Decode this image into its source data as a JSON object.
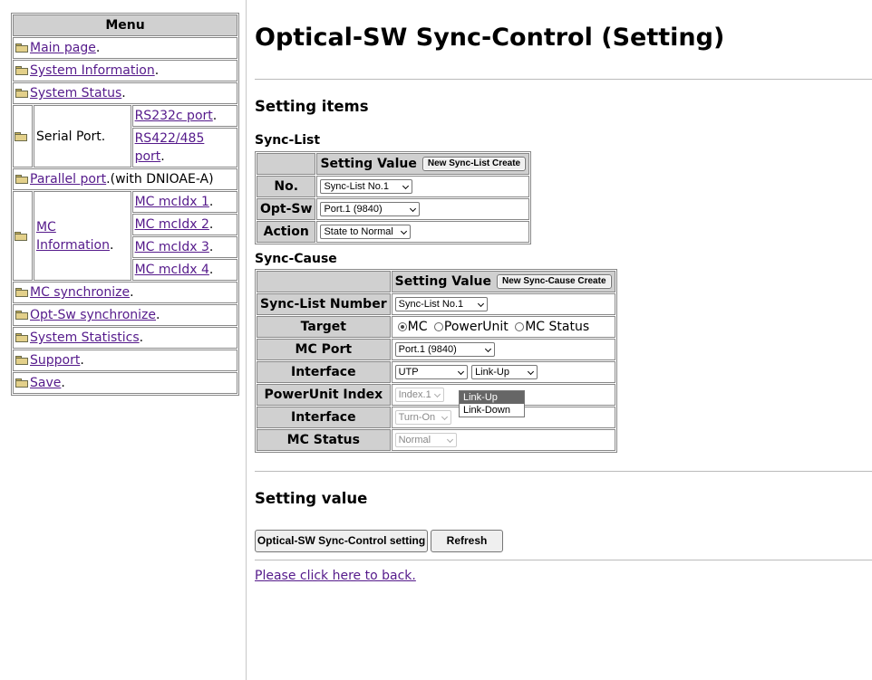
{
  "menu": {
    "title": "Menu",
    "main_page": "Main page",
    "system_information": "System Information",
    "system_status": "System Status",
    "serial_port": "Serial Port.",
    "rs232c_port": "RS232c port",
    "rs422_485_port_line1": "RS422/485",
    "rs422_485_port_line2": "port",
    "parallel_port": "Parallel port",
    "parallel_suffix": "(with DNIOAE-A)",
    "mc_information_line1": "MC",
    "mc_information_line2": "Information",
    "mc_idx_1": "MC mcIdx 1",
    "mc_idx_2": "MC mcIdx 2",
    "mc_idx_3": "MC mcIdx 3",
    "mc_idx_4": "MC mcIdx 4",
    "mc_synchronize": "MC synchronize",
    "opt_sw_synchronize": "Opt-Sw synchronize",
    "system_statistics": "System Statistics",
    "support": "Support",
    "save": "Save",
    "dot": "."
  },
  "page": {
    "title": "Optical-SW Sync-Control (Setting)",
    "setting_items": "Setting items",
    "sync_list_heading": "Sync-List",
    "sync_cause_heading": "Sync-Cause",
    "setting_value_heading": "Setting value",
    "back_link": "Please click here to back."
  },
  "sync_list": {
    "header": "Setting Value",
    "create_button": "New Sync-List Create",
    "no_label": "No.",
    "no_value": "Sync-List No.1",
    "optsw_label": "Opt-Sw",
    "optsw_value": "Port.1 (9840)",
    "action_label": "Action",
    "action_value": "State to Normal"
  },
  "sync_cause": {
    "header": "Setting Value",
    "create_button": "New Sync-Cause Create",
    "sync_list_number_label": "Sync-List Number",
    "sync_list_number_value": "Sync-List No.1",
    "target_label": "Target",
    "target_options": [
      "MC",
      "PowerUnit",
      "MC Status"
    ],
    "target_selected": "MC",
    "mc_port_label": "MC Port",
    "mc_port_value": "Port.1 (9840)",
    "interface_label": "Interface",
    "interface_value": "UTP",
    "link_value": "Link-Up",
    "link_options": [
      "Link-Up",
      "Link-Down"
    ],
    "powerunit_index_label": "PowerUnit Index",
    "powerunit_index_value": "Index.1",
    "interface2_label": "Interface",
    "interface2_value": "Turn-On",
    "mc_status_label": "MC Status",
    "mc_status_value": "Normal"
  },
  "buttons": {
    "setting": "Optical-SW Sync-Control setting",
    "refresh": "Refresh"
  },
  "colors": {
    "label_bg": "#d0d0d0",
    "link": "#551a8b",
    "dropdown_highlight": "#666666"
  }
}
